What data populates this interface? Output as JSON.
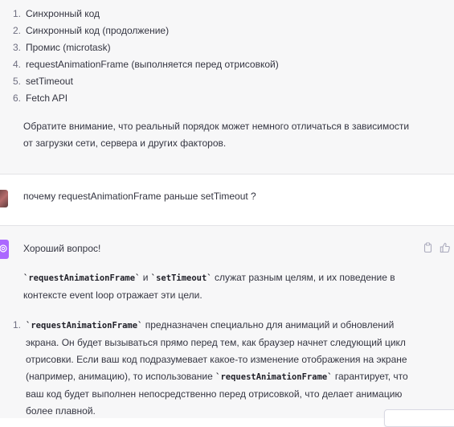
{
  "order_list": [
    {
      "num": "1.",
      "text": "Синхронный код"
    },
    {
      "num": "2.",
      "text": "Синхронный код (продолжение)"
    },
    {
      "num": "3.",
      "text": "Промис (microtask)"
    },
    {
      "num": "4.",
      "text": "requestAnimationFrame (выполняется перед отрисовкой)"
    },
    {
      "num": "5.",
      "text": "setTimeout"
    },
    {
      "num": "6.",
      "text": "Fetch API"
    }
  ],
  "note": "Обратите внимание, что реальный порядок может немного отличаться в зависимости от загрузки сети, сервера и других факторов.",
  "user_message": "почему requestAnimationFrame  раньше setTimeout ?",
  "assistant": {
    "greeting": "Хороший вопрос!",
    "intro": {
      "code1": "`requestAnimationFrame`",
      "and": " и ",
      "code2": "`setTimeout`",
      "rest": " служат разным целям, и их поведение в контексте event loop отражает эти цели."
    },
    "point1": {
      "num": "1.",
      "code": "`requestAnimationFrame`",
      "text1": " предназначен специально для анимаций и обновлений экрана. Он будет вызываться прямо перед тем, как браузер начнет следующий цикл отрисовки. Если ваш код подразумевает какое-то изменение отображения на экране (например, анимацию), то использование ",
      "code2": "`requestAnimationFrame`",
      "text2": " гарантирует, что ваш код будет выполнен непосредственно перед отрисовкой, что делает анимацию более плавной."
    }
  },
  "icons": [
    "copy-icon",
    "thumbs-up-icon",
    "openai-logo-icon"
  ],
  "colors": {
    "assistant_bg": "#f7f7f8",
    "gpt_avatar": "#ab68ff",
    "text": "#343541"
  }
}
